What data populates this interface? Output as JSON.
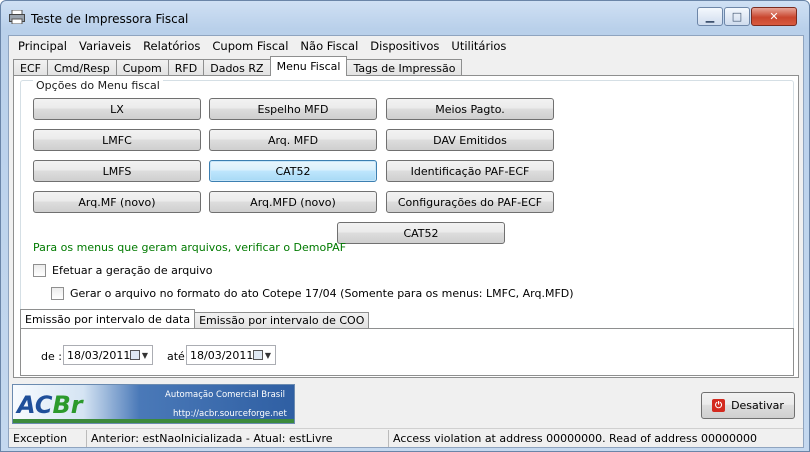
{
  "window": {
    "title": "Teste de Impressora Fiscal",
    "controls": {
      "minimize": "▁",
      "maximize": "□",
      "close": "✕"
    }
  },
  "menubar": [
    "Principal",
    "Variaveis",
    "Relatórios",
    "Cupom Fiscal",
    "Não Fiscal",
    "Dispositivos",
    "Utilitários"
  ],
  "tabs": [
    "ECF",
    "Cmd/Resp",
    "Cupom",
    "RFD",
    "Dados RZ",
    "Menu Fiscal",
    "Tags de Impressão"
  ],
  "active_tab": "Menu Fiscal",
  "group": {
    "label": "Opções do Menu fiscal",
    "buttons": {
      "lx": "LX",
      "espelho_mfd": "Espelho MFD",
      "meios_pagto": "Meios Pagto.",
      "lmfc": "LMFC",
      "arq_mfd": "Arq. MFD",
      "dav_emitidos": "DAV Emitidos",
      "lmfs": "LMFS",
      "cat52": "CAT52",
      "identificacao_paf": "Identificação PAF-ECF",
      "arq_mf_novo": "Arq.MF (novo)",
      "arq_mfd_novo": "Arq.MFD (novo)",
      "configuracoes_paf": "Configurações do PAF-ECF",
      "cat52_second": "CAT52"
    },
    "note": "Para os menus que geram arquivos, verificar o DemoPAF"
  },
  "checkboxes": {
    "efetuar": "Efetuar a geração de arquivo",
    "cotepe": "Gerar o arquivo no formato do ato Cotepe 17/04 (Somente para os menus: LMFC, Arq.MFD)"
  },
  "subtabs": [
    "Emissão por intervalo de data",
    "Emissão por intervalo de COO"
  ],
  "dates": {
    "de_label": "de :",
    "de_value": "18/03/2011",
    "ate_label": "até",
    "ate_value": "18/03/2011"
  },
  "logo": {
    "brand": "ACBr",
    "line1": "Automação Comercial Brasil",
    "line2": "http://acbr.sourceforge.net"
  },
  "desativar_label": "Desativar",
  "status": {
    "cell1": "Exception",
    "cell2": "Anterior: estNaoInicializada - Atual: estLivre",
    "cell3": "Access violation at address 00000000. Read of address 00000000"
  }
}
